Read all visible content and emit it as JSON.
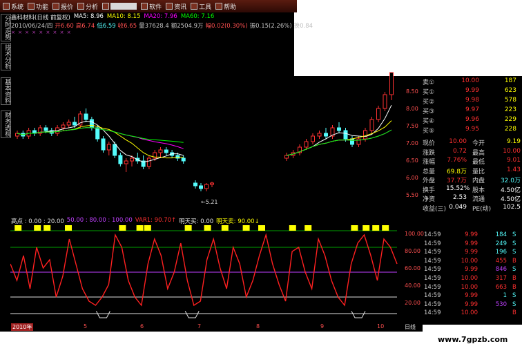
{
  "menu": {
    "items": [
      {
        "label": "系统",
        "active": false
      },
      {
        "label": "功能",
        "active": false
      },
      {
        "label": "报价",
        "active": false
      },
      {
        "label": "分析",
        "active": false
      },
      {
        "label": "",
        "active": true
      },
      {
        "label": "软件",
        "active": false
      },
      {
        "label": "资讯",
        "active": false
      },
      {
        "label": "工具",
        "active": false
      },
      {
        "label": "帮助",
        "active": false
      }
    ]
  },
  "side_tabs": [
    "分时走势",
    "技术分析",
    "基本资料",
    "财务透视"
  ],
  "info_line": {
    "stock": "鑫科材料(日线 前复权)",
    "ma5": "MA5: 8.96",
    "ma10": "MA10: 8.15",
    "ma20": "MA20: 7.96",
    "ma60": "MA60: 7.16"
  },
  "detail_line": {
    "date": "2010/06/24/四",
    "open": "开6.60",
    "high": "高6.74",
    "low": "低6.59",
    "close": "收6.65",
    "volume": "量37628.4",
    "amount": "额2504.9万",
    "change": "幅0.02(0.30%)",
    "amplitude": "振0.15(2.26%)",
    "turnover": "换0.84"
  },
  "price_scale": [
    "8.50",
    "8.00",
    "7.50",
    "7.00",
    "6.50",
    "6.00",
    "5.50"
  ],
  "low_label": "5.21",
  "order_book": [
    {
      "label": "卖①",
      "price": "10.00",
      "vol": "187"
    },
    {
      "label": "买①",
      "price": "9.99",
      "vol": "623"
    },
    {
      "label": "买②",
      "price": "9.98",
      "vol": "578"
    },
    {
      "label": "买③",
      "price": "9.97",
      "vol": "223"
    },
    {
      "label": "买④",
      "price": "9.96",
      "vol": "229"
    },
    {
      "label": "买⑤",
      "price": "9.95",
      "vol": "228"
    }
  ],
  "stats": [
    {
      "l1": "现价",
      "v1": "10.00",
      "l2": "今开",
      "v2": "9.19"
    },
    {
      "l1": "涨跌",
      "v1": "0.72",
      "l2": "最高",
      "v2": "10.00"
    },
    {
      "l1": "涨幅",
      "v1": "7.76%",
      "l2": "最低",
      "v2": "9.01"
    },
    {
      "l1": "总量",
      "v1": "69.8万",
      "l2": "量比",
      "v2": "1.43"
    },
    {
      "l1": "外盘",
      "v1": "37.7万",
      "l2": "内盘",
      "v2": "32.0万"
    },
    {
      "l1": "换手",
      "v1": "15.52%",
      "l2": "股本",
      "v2": "4.50亿"
    },
    {
      "l1": "净资",
      "v1": "2.53",
      "l2": "流通",
      "v2": "4.50亿"
    },
    {
      "l1": "收益(三)",
      "v1": "0.049",
      "l2": "PE(动)",
      "v2": "102.5"
    }
  ],
  "ticks": [
    {
      "time": "14:59",
      "price": "9.99",
      "vol": "184",
      "side": "S"
    },
    {
      "time": "14:59",
      "price": "9.99",
      "vol": "249",
      "side": "S"
    },
    {
      "time": "14:59",
      "price": "9.99",
      "vol": "196",
      "side": "S"
    },
    {
      "time": "14:59",
      "price": "10.00",
      "vol": "455",
      "side": "B"
    },
    {
      "time": "14:59",
      "price": "9.99",
      "vol": "846",
      "side": "S"
    },
    {
      "time": "14:59",
      "price": "10.00",
      "vol": "317",
      "side": "B"
    },
    {
      "time": "14:59",
      "price": "10.00",
      "vol": "663",
      "side": "B"
    },
    {
      "time": "14:59",
      "price": "9.99",
      "vol": "1",
      "side": "S"
    },
    {
      "time": "14:59",
      "price": "9.99",
      "vol": "530",
      "side": "S"
    },
    {
      "time": "14:59",
      "price": "10.00",
      "vol": "",
      "side": "B"
    }
  ],
  "indicator_header": {
    "name": "高点 : 0.00 : 20.00",
    "lvl50": "50.00 : 80.00 : 100.00",
    "var1": "VAR1: 90.70↑",
    "tomorrow_buy": "明天买: 0.00",
    "tomorrow_sell": "明天卖: 90.00↓"
  },
  "indicator_scale": [
    "100.00",
    "80.00",
    "60.00",
    "40.00",
    "20.00"
  ],
  "x_axis": [
    "2010年",
    "5",
    "6",
    "7",
    "8",
    "9",
    "10"
  ],
  "period_tab": "日线",
  "watermark": "www.7gpzb.com",
  "colors": {
    "up": "#ff3232",
    "down": "#54fcfc",
    "ma5": "#ffffff",
    "ma10": "#ffff00",
    "ma20": "#ff00ff",
    "ma60": "#00ff00",
    "indicator": "#ff2020",
    "signal": "#ffff00"
  },
  "chart_data": {
    "type": "line",
    "title": "",
    "ylim": [
      5.0,
      10.0
    ],
    "candles": [
      [
        7.7,
        7.9,
        7.6,
        7.8
      ],
      [
        7.8,
        7.9,
        7.6,
        7.7
      ],
      [
        7.7,
        8.0,
        7.6,
        7.9
      ],
      [
        7.9,
        8.0,
        7.7,
        7.8
      ],
      [
        7.8,
        8.1,
        7.7,
        8.0
      ],
      [
        8.0,
        8.1,
        7.8,
        7.9
      ],
      [
        7.9,
        8.0,
        7.7,
        7.8
      ],
      [
        7.8,
        8.1,
        7.7,
        8.0
      ],
      [
        8.0,
        8.2,
        7.9,
        8.1
      ],
      [
        8.1,
        8.3,
        8.0,
        8.2
      ],
      [
        8.2,
        8.4,
        8.0,
        8.1
      ],
      [
        8.1,
        8.6,
        8.0,
        8.5
      ],
      [
        8.5,
        8.7,
        8.2,
        8.3
      ],
      [
        8.3,
        8.4,
        7.9,
        8.0
      ],
      [
        8.0,
        8.1,
        7.5,
        7.6
      ],
      [
        7.6,
        7.7,
        7.1,
        7.2
      ],
      [
        7.2,
        7.5,
        7.0,
        7.4
      ],
      [
        7.4,
        7.5,
        6.9,
        7.0
      ],
      [
        7.0,
        7.1,
        6.6,
        6.7
      ],
      [
        6.7,
        6.9,
        6.4,
        6.8
      ],
      [
        6.8,
        7.0,
        6.6,
        6.9
      ],
      [
        6.9,
        7.1,
        6.7,
        6.8
      ],
      [
        6.8,
        7.0,
        6.5,
        6.6
      ],
      [
        6.6,
        7.0,
        6.5,
        6.9
      ],
      [
        6.9,
        7.2,
        6.8,
        7.1
      ],
      [
        7.1,
        7.3,
        6.9,
        7.2
      ],
      [
        7.2,
        7.3,
        7.0,
        7.1
      ],
      [
        7.1,
        7.2,
        6.9,
        7.0
      ],
      [
        7.0,
        7.1,
        6.8,
        6.9
      ],
      [
        6.9,
        7.0,
        6.7,
        6.8
      ]
    ],
    "candles_right": [
      [
        6.9,
        7.1,
        6.8,
        7.0
      ],
      [
        7.0,
        7.2,
        6.9,
        7.1
      ],
      [
        7.1,
        7.4,
        7.0,
        7.3
      ],
      [
        7.3,
        7.6,
        7.2,
        7.5
      ],
      [
        7.5,
        7.8,
        7.4,
        7.7
      ],
      [
        7.7,
        7.9,
        7.6,
        7.8
      ],
      [
        7.8,
        8.0,
        7.6,
        7.7
      ],
      [
        7.7,
        8.1,
        7.6,
        8.0
      ],
      [
        8.0,
        8.2,
        7.8,
        7.9
      ],
      [
        7.9,
        8.0,
        7.5,
        7.6
      ],
      [
        7.6,
        7.7,
        7.3,
        7.4
      ],
      [
        7.4,
        7.7,
        7.3,
        7.6
      ],
      [
        7.6,
        8.0,
        7.5,
        7.9
      ],
      [
        7.9,
        8.4,
        7.8,
        8.3
      ],
      [
        8.3,
        8.8,
        8.2,
        8.7
      ],
      [
        8.7,
        9.3,
        8.6,
        9.2
      ],
      [
        9.2,
        10.0,
        9.0,
        10.0
      ]
    ],
    "indicator": [
      60,
      40,
      70,
      30,
      80,
      55,
      65,
      20,
      45,
      90,
      60,
      30,
      15,
      10,
      20,
      35,
      95,
      80,
      40,
      20,
      10,
      60,
      90,
      70,
      30,
      50,
      85,
      40,
      10,
      15,
      65,
      90,
      55,
      30,
      80,
      60,
      20,
      40,
      70,
      95,
      60,
      35,
      15,
      75,
      80,
      50,
      30,
      90,
      70,
      40,
      20,
      10,
      60,
      85,
      95,
      70,
      40,
      90,
      80,
      60
    ],
    "signals_x": [
      0.02,
      0.07,
      0.095,
      0.15,
      0.29,
      0.335,
      0.355,
      0.46,
      0.51,
      0.555,
      0.61,
      0.65,
      0.73,
      0.77,
      0.89,
      0.92,
      0.945,
      0.97
    ]
  }
}
